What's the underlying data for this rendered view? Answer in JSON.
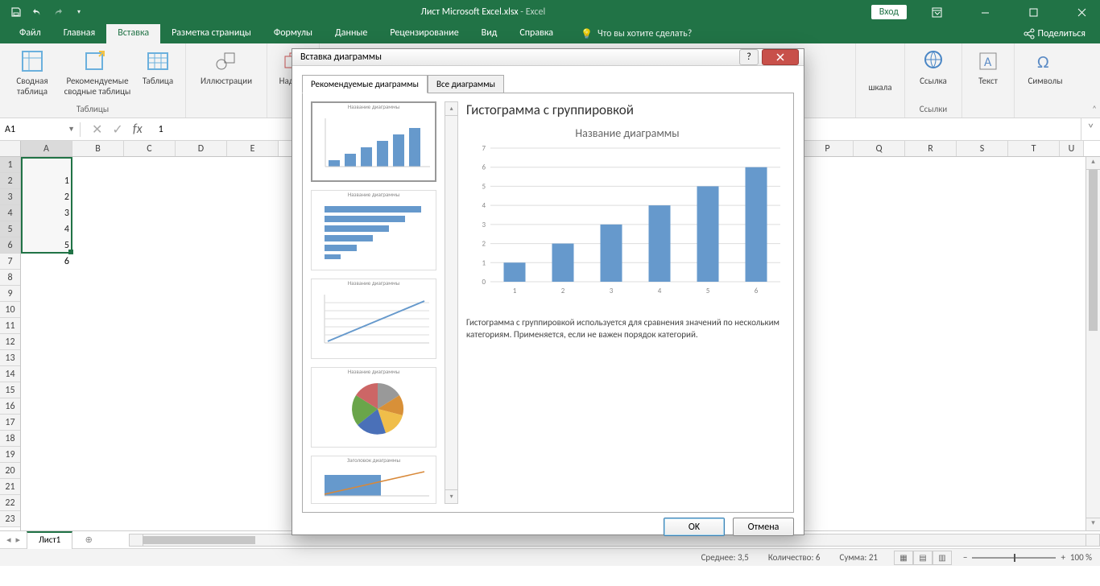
{
  "window": {
    "title": "Лист Microsoft Excel.xlsx",
    "suffix": " - Excel",
    "login": "Вход"
  },
  "ribbon_tabs": [
    "Файл",
    "Главная",
    "Вставка",
    "Разметка страницы",
    "Формулы",
    "Данные",
    "Рецензирование",
    "Вид",
    "Справка"
  ],
  "active_tab_index": 2,
  "tellme": "Что вы хотите сделать?",
  "share": "Поделиться",
  "ribbon": {
    "pivot": "Сводная таблица",
    "rec_pivot": "Рекомендуемые сводные таблицы",
    "table": "Таблица",
    "tables_group": "Таблицы",
    "illustrations": "Иллюстрации",
    "addins": "Надст…",
    "scale": "шкала",
    "link": "Ссылка",
    "links_group": "Ссылки",
    "text": "Текст",
    "symbols": "Символы"
  },
  "namebox": "A1",
  "formula_value": "1",
  "cols": [
    "A",
    "B",
    "C",
    "D",
    "E",
    "P",
    "Q",
    "R",
    "S",
    "T",
    "U"
  ],
  "cell_values": [
    "1",
    "2",
    "3",
    "4",
    "5",
    "6"
  ],
  "sheet_name": "Лист1",
  "status": {
    "avg_label": "Среднее:",
    "avg": "3,5",
    "count_label": "Количество:",
    "count": "6",
    "sum_label": "Сумма:",
    "sum": "21",
    "zoom": "100 %"
  },
  "dialog": {
    "title": "Вставка диаграммы",
    "tab_rec": "Рекомендуемые диаграммы",
    "tab_all": "Все диаграммы",
    "thumb_title": "Название диаграммы",
    "thumb_title2": "Заголовок диаграммы",
    "preview_heading": "Гистограмма с группировкой",
    "preview_title": "Название диаграммы",
    "description": "Гистограмма с группировкой используется для сравнения значений по нескольким категориям. Применяется, если не важен порядок категорий.",
    "ok": "OK",
    "cancel": "Отмена"
  },
  "chart_data": {
    "type": "bar",
    "title": "Название диаграммы",
    "categories": [
      "1",
      "2",
      "3",
      "4",
      "5",
      "6"
    ],
    "values": [
      1,
      2,
      3,
      4,
      5,
      6
    ],
    "yticks": [
      0,
      1,
      2,
      3,
      4,
      5,
      6,
      7
    ],
    "ylim": [
      0,
      7
    ],
    "xlabel": "",
    "ylabel": ""
  }
}
